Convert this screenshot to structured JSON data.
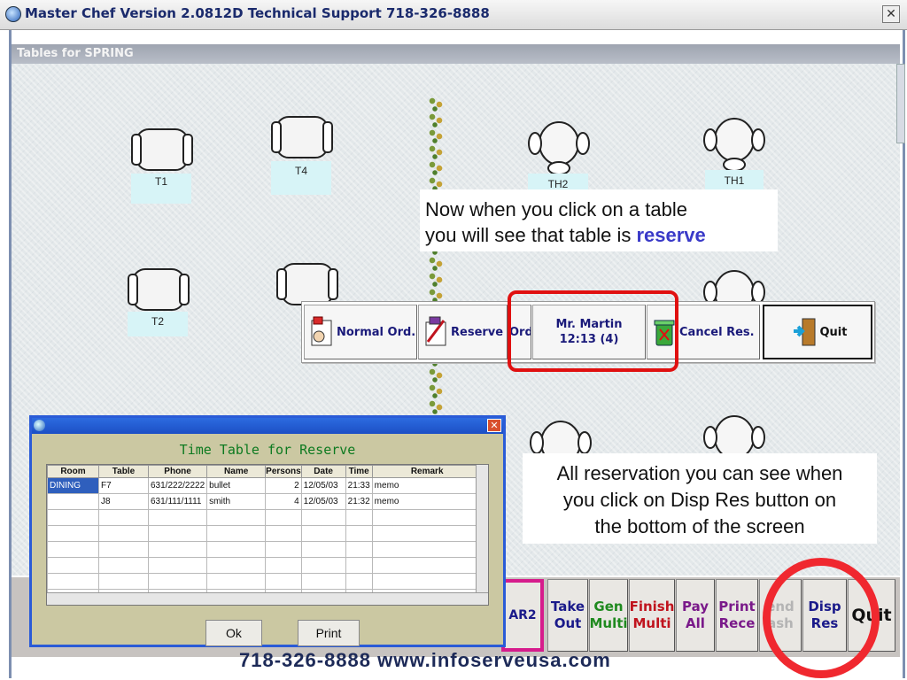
{
  "window": {
    "title": "Master Chef Version 2.0812D Technical Support 718-326-8888",
    "close_glyph": "✕"
  },
  "floor": {
    "header": "Tables for SPRING",
    "square_tables": [
      "T1",
      "T4",
      "T2"
    ],
    "round_tables": [
      "TH2",
      "TH1"
    ]
  },
  "callouts": {
    "reserve_line1": "Now when you click on a table",
    "reserve_line2_prefix": "you will see that table is ",
    "reserve_word": "reserve",
    "dispres_line1": "All reservation you can see when",
    "dispres_line2": "you click on Disp Res button on",
    "dispres_line3": "the bottom of the screen"
  },
  "popup": {
    "normal_order": "Normal Ord.",
    "reserve": "Reserve",
    "reserve_cut": "Ord",
    "reservation_name": "Mr. Martin",
    "reservation_time": "12:13 (4)",
    "cancel_res": "Cancel Res.",
    "quit": "Quit"
  },
  "dialog": {
    "heading": "Time Table for Reserve",
    "close_glyph": "✕",
    "columns": [
      "Room",
      "Table",
      "Phone",
      "Name",
      "Persons",
      "Date",
      "Time",
      "Remark"
    ],
    "rows": [
      {
        "room": "DINING",
        "table": "F7",
        "phone": "631/222/2222",
        "name": "bullet",
        "persons": "2",
        "date": "12/05/03",
        "time": "21:33",
        "remark": "memo"
      },
      {
        "room": "",
        "table": "J8",
        "phone": "631/111/1111",
        "name": "smith",
        "persons": "4",
        "date": "12/05/03",
        "time": "21:32",
        "remark": "memo"
      }
    ],
    "ok_label": "Ok",
    "print_label": "Print"
  },
  "bottom": {
    "partial_left": "AR2",
    "take_out": [
      "Take",
      "Out"
    ],
    "gen_multi": [
      "Gen",
      "Multi"
    ],
    "finish_multi": [
      "Finish",
      "Multi"
    ],
    "pay_all": [
      "Pay",
      "All"
    ],
    "print_rece": [
      "Print",
      "Rece"
    ],
    "send_cash": [
      "end",
      "ash"
    ],
    "disp_res": [
      "Disp",
      "Res"
    ],
    "quit": "Quit",
    "footer": "718-326-8888  www.infoserveusa.com",
    "colors": {
      "green": "#1f8a1f",
      "red": "#c0141e",
      "purple": "#7a1a8a",
      "blue": "#1a1a8a"
    }
  }
}
